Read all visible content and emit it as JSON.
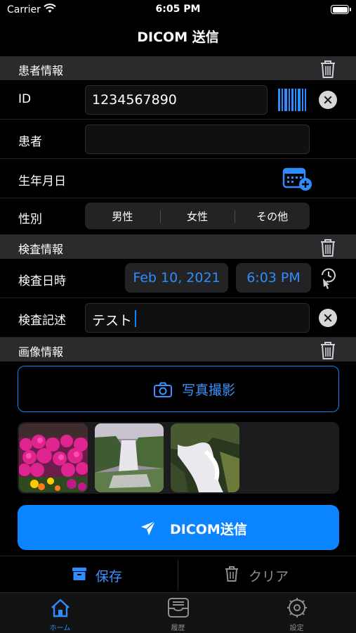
{
  "status_bar": {
    "carrier": "Carrier",
    "time": "6:05 PM"
  },
  "nav": {
    "title": "DICOM 送信"
  },
  "patient_section": {
    "title": "患者情報",
    "id_label": "ID",
    "id_value": "1234567890",
    "patient_label": "患者",
    "patient_value": "",
    "birth_label": "生年月日",
    "sex_label": "性別",
    "sex_options": [
      "男性",
      "女性",
      "その他"
    ]
  },
  "exam_section": {
    "title": "検査情報",
    "datetime_label": "検査日時",
    "date_value": "Feb 10, 2021",
    "time_value": "6:03 PM",
    "description_label": "検査記述",
    "description_value": "テスト"
  },
  "image_section": {
    "title": "画像情報",
    "take_photo_label": "写真撮影"
  },
  "actions": {
    "send_label": "DICOM送信",
    "save_label": "保存",
    "clear_label": "クリア"
  },
  "tabbar": {
    "tabs": [
      {
        "label": "ホーム",
        "icon": "home-icon",
        "active": true
      },
      {
        "label": "履歴",
        "icon": "history-tray-icon",
        "active": false
      },
      {
        "label": "設定",
        "icon": "settings-gear-icon",
        "active": false
      }
    ]
  },
  "colors": {
    "accent": "#0a84ff",
    "background": "#000000",
    "section_header": "#2b2b2d",
    "inactive": "#8e8e93"
  }
}
